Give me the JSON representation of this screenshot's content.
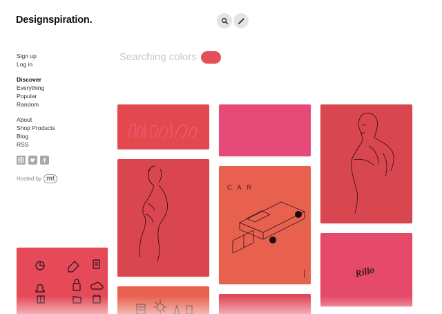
{
  "header": {
    "logo": "Designspiration",
    "logo_dot": "."
  },
  "sidebar": {
    "account": [
      "Sign up",
      "Log in"
    ],
    "discover_heading": "Discover",
    "discover": [
      "Everything",
      "Popular",
      "Random"
    ],
    "links": [
      "About",
      "Shop Products",
      "Blog",
      "RSS"
    ],
    "social": [
      "instagram-icon",
      "twitter-icon",
      "facebook-icon"
    ],
    "hosted_by": "Hosted by",
    "hosted_logo": "mt"
  },
  "search": {
    "label": "Searching colors",
    "color": "#e2515a"
  },
  "cards": {
    "car_text": "C A R",
    "rillo_text": "Rillo"
  },
  "colors": {
    "coral": "#e2515a",
    "pink": "#e64c78",
    "red": "#d5454d",
    "orange": "#e8614f"
  }
}
